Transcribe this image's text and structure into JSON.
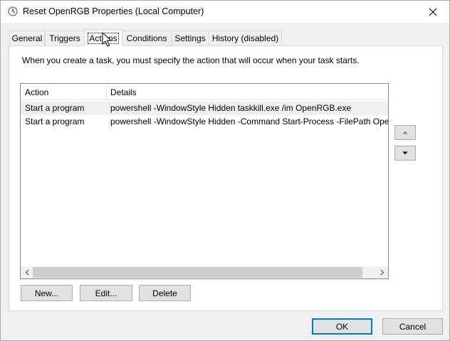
{
  "window": {
    "title": "Reset OpenRGB Properties (Local Computer)"
  },
  "tabs": [
    {
      "label": "General"
    },
    {
      "label": "Triggers"
    },
    {
      "label": "Actions"
    },
    {
      "label": "Conditions"
    },
    {
      "label": "Settings"
    },
    {
      "label": "History (disabled)"
    }
  ],
  "actions_tab": {
    "intro": "When you create a task, you must specify the action that will occur when your task starts.",
    "columns": {
      "action": "Action",
      "details": "Details"
    },
    "rows": [
      {
        "action": "Start a program",
        "details": "powershell -WindowStyle Hidden taskkill.exe /im OpenRGB.exe"
      },
      {
        "action": "Start a program",
        "details": "powershell -WindowStyle Hidden -Command Start-Process -FilePath Open"
      }
    ],
    "buttons": {
      "new": "New...",
      "edit": "Edit...",
      "delete": "Delete"
    }
  },
  "footer": {
    "ok": "OK",
    "cancel": "Cancel"
  },
  "colors": {
    "accent": "#0078d7",
    "selected_row": "#f0f0f0"
  }
}
